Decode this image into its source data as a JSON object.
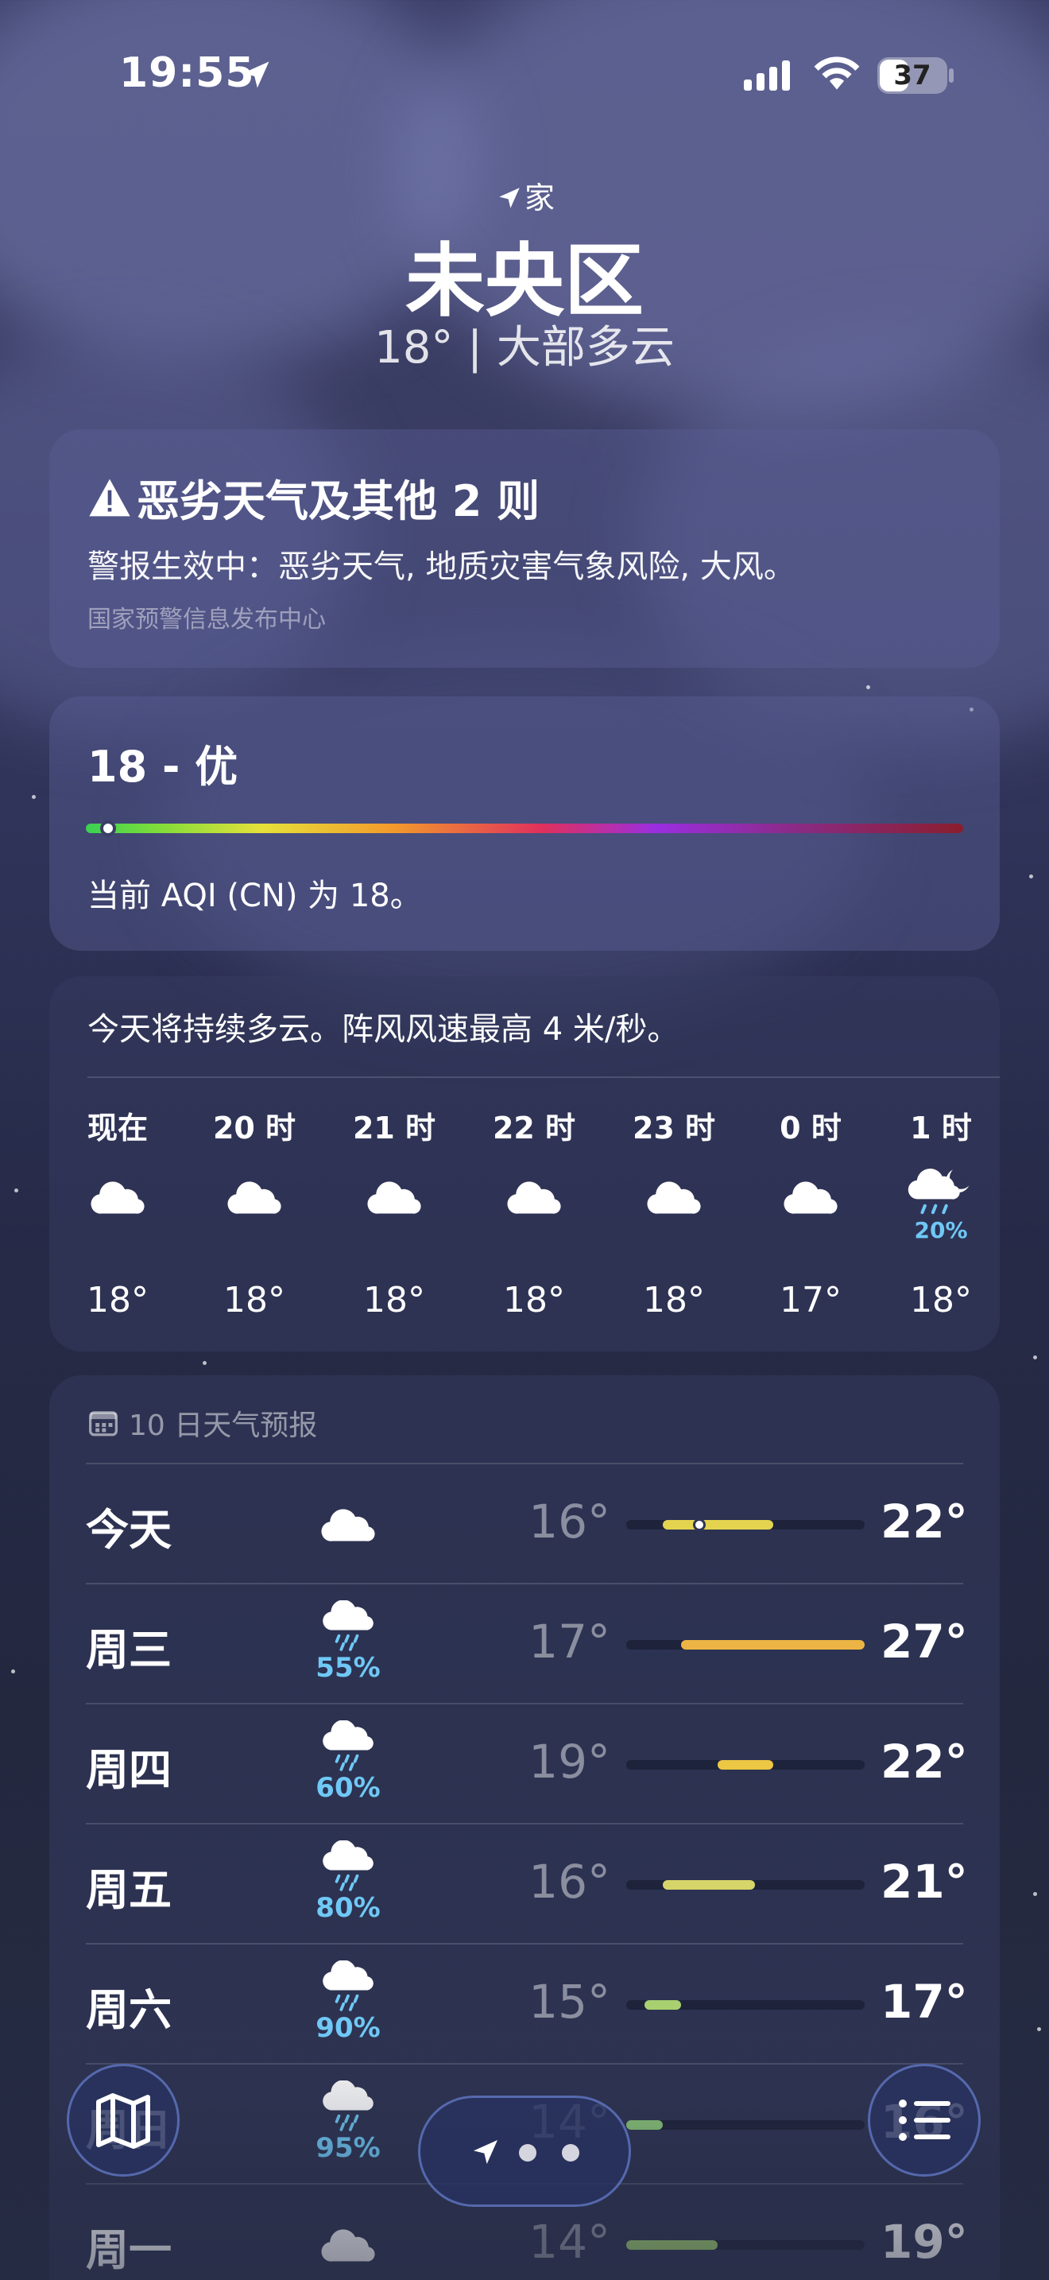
{
  "status": {
    "time": "19:55",
    "battery": "37"
  },
  "location": {
    "label": "家",
    "city": "未央区",
    "summary": "18° | 大部多云"
  },
  "alert": {
    "title": "恶劣天气及其他 2 则",
    "body": "警报生效中：恶劣天气, 地质灾害气象风险, 大风。",
    "source": "国家预警信息发布中心"
  },
  "aqi": {
    "title": "18 - 优",
    "value": 18,
    "description": "当前 AQI (CN) 为 18。"
  },
  "hourly": {
    "summary": "今天将持续多云。阵风风速最高 4 米/秒。",
    "items": [
      {
        "label": "现在",
        "icon": "cloud-icon",
        "temp": "18°"
      },
      {
        "label": "20 时",
        "icon": "cloud-icon",
        "temp": "18°"
      },
      {
        "label": "21 时",
        "icon": "cloud-icon",
        "temp": "18°"
      },
      {
        "label": "22 时",
        "icon": "cloud-icon",
        "temp": "18°"
      },
      {
        "label": "23 时",
        "icon": "cloud-icon",
        "temp": "18°"
      },
      {
        "label": "0 时",
        "icon": "cloud-icon",
        "temp": "17°"
      },
      {
        "label": "1 时",
        "icon": "cloud-moon-rain-icon",
        "pct": "20%",
        "temp": "18°"
      }
    ]
  },
  "forecast": {
    "title": "10 日天气预报",
    "range": [
      14,
      27
    ],
    "days": [
      {
        "day": "今天",
        "icon": "cloud-icon",
        "pct": "",
        "low": "16°",
        "high": "22°",
        "low_v": 16,
        "high_v": 22,
        "color": "#e4d34f",
        "current": 18
      },
      {
        "day": "周三",
        "icon": "cloud-rain-icon",
        "pct": "55%",
        "low": "17°",
        "high": "27°",
        "low_v": 17,
        "high_v": 27,
        "color": "#ecb444"
      },
      {
        "day": "周四",
        "icon": "cloud-rain-icon",
        "pct": "60%",
        "low": "19°",
        "high": "22°",
        "low_v": 19,
        "high_v": 22,
        "color": "#ecc744"
      },
      {
        "day": "周五",
        "icon": "cloud-rain-icon",
        "pct": "80%",
        "low": "16°",
        "high": "21°",
        "low_v": 16,
        "high_v": 21,
        "color": "#d6d56a"
      },
      {
        "day": "周六",
        "icon": "cloud-rain-icon",
        "pct": "90%",
        "low": "15°",
        "high": "17°",
        "low_v": 15,
        "high_v": 17,
        "color": "#a8d070"
      },
      {
        "day": "周日",
        "icon": "cloud-rain-icon",
        "pct": "95%",
        "low": "14°",
        "high": "16°",
        "low_v": 14,
        "high_v": 16,
        "color": "#8cc878"
      },
      {
        "day": "周一",
        "icon": "cloud-icon",
        "pct": "",
        "low": "14°",
        "high": "19°",
        "low_v": 14,
        "high_v": 19,
        "color": "#a0d070"
      }
    ]
  },
  "toolbar": {
    "page_dots": 2
  }
}
